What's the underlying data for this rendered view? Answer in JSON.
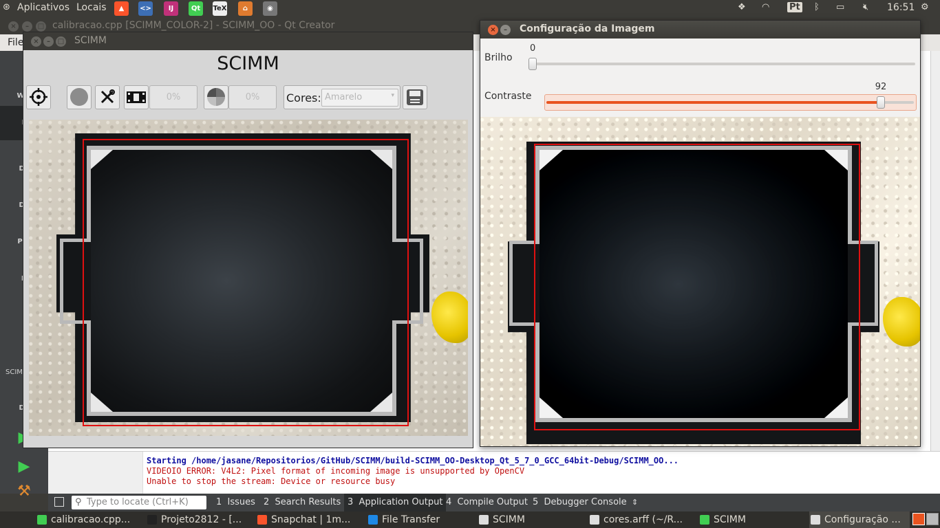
{
  "top_panel": {
    "apps_menu": "Aplicativos",
    "places_menu": "Locais",
    "keyboard_layout": "Pt",
    "clock": "16:51"
  },
  "qtcreator": {
    "window_title": "calibracao.cpp [SCIMM_COLOR-2] - SCIMM_OO - Qt Creator",
    "menu_file": "File",
    "sidebar": [
      "Wel",
      "E",
      "De",
      "De",
      "Pro",
      "H"
    ],
    "sidebar_project": "SCIM",
    "sidebar_bottom_label": "De",
    "output_lines": [
      {
        "text": "Starting /home/jasane/Repositorios/GitHub/SCIMM/build-SCIMM_OO-Desktop_Qt_5_7_0_GCC_64bit-Debug/SCIMM_OO...",
        "color": "#1010a0",
        "bold": true
      },
      {
        "text": "VIDEOIO ERROR: V4L2: Pixel format of incoming image is unsupported by OpenCV",
        "color": "#c01010",
        "bold": false
      },
      {
        "text": "Unable to stop the stream: Device or resource busy",
        "color": "#c01010",
        "bold": false
      }
    ],
    "locator_placeholder": "Type to locate (Ctrl+K)",
    "panes": [
      {
        "num": "1",
        "label": "Issues"
      },
      {
        "num": "2",
        "label": "Search Results"
      },
      {
        "num": "3",
        "label": "Application Output"
      },
      {
        "num": "4",
        "label": "Compile Output"
      },
      {
        "num": "5",
        "label": "Debugger Console"
      }
    ]
  },
  "scimm_window": {
    "title": "SCIMM",
    "heading": "SCIMM",
    "progress1": "0%",
    "progress2": "0%",
    "cores_label": "Cores:",
    "cores_value": "Amarelo"
  },
  "config_window": {
    "title": "Configuração da Imagem",
    "brilho_label": "Brilho",
    "brilho_value": "0",
    "brilho_fraction": 0.0,
    "contraste_label": "Contraste",
    "contraste_value": "92",
    "contraste_fraction": 0.92
  },
  "taskbar": [
    {
      "label": "calibracao.cpp...",
      "color": "#41cd52"
    },
    {
      "label": "Projeto2812 - [...",
      "color": "#222222"
    },
    {
      "label": "Snapchat | 1m...",
      "color": "#fb542b"
    },
    {
      "label": "File Transfer",
      "color": "#1e88e5"
    },
    {
      "label": "SCIMM",
      "color": "#dddddd"
    },
    {
      "label": "cores.arff (~/R...",
      "color": "#dddddd"
    },
    {
      "label": "SCIMM",
      "color": "#41cd52"
    },
    {
      "label": "Configuração ...",
      "color": "#dddddd"
    }
  ],
  "colors": {
    "ubuntu_orange": "#e95420",
    "panel_bg": "#3c3b37",
    "detection_rect": "#e01010"
  }
}
